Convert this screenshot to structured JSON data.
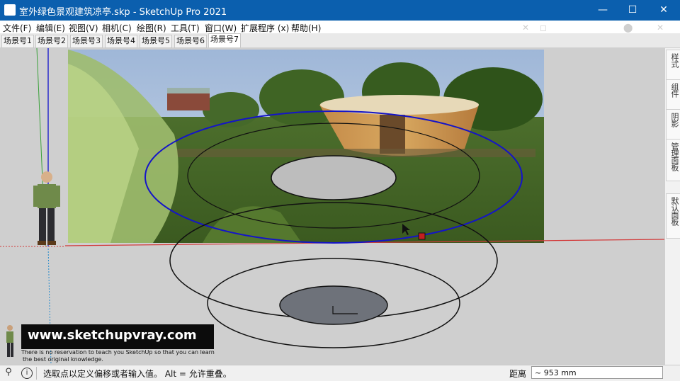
{
  "window": {
    "title": "室外绿色景观建筑凉亭.skp - SketchUp Pro 2021",
    "minimize": "—",
    "maximize": "☐",
    "close": "✕",
    "ghost_controls": [
      "✕",
      "◻",
      "⬤",
      "✕"
    ]
  },
  "menu": [
    "文件(F)",
    "编辑(E)",
    "视图(V)",
    "相机(C)",
    "绘图(R)",
    "工具(T)",
    "窗口(W)",
    "扩展程序 (x)",
    "帮助(H)"
  ],
  "scenes": [
    "场景号1",
    "场景号2",
    "场景号3",
    "场景号4",
    "场景号5",
    "场景号6",
    "场景号7"
  ],
  "active_scene": "场景号7",
  "right_panel": [
    "样式",
    "组件",
    "阴影",
    "管理面板",
    "默认面板"
  ],
  "status": {
    "message": "选取点以定义偏移或者输入值。 Alt = 允许重叠。",
    "measure_label": "距离",
    "measure_value": "~ 953 mm"
  },
  "watermark": {
    "url": "www.sketchupvray.com",
    "line1": "There is no reservation to teach you SketchUp so that you can learn",
    "line2": "the best original knowledge."
  },
  "colors": {
    "titlebar": "#0b5fae",
    "selection": "#1414c8",
    "axis_red": "#d23a3a",
    "axis_green": "#3aa13a",
    "axis_blue": "#2a2acc"
  }
}
